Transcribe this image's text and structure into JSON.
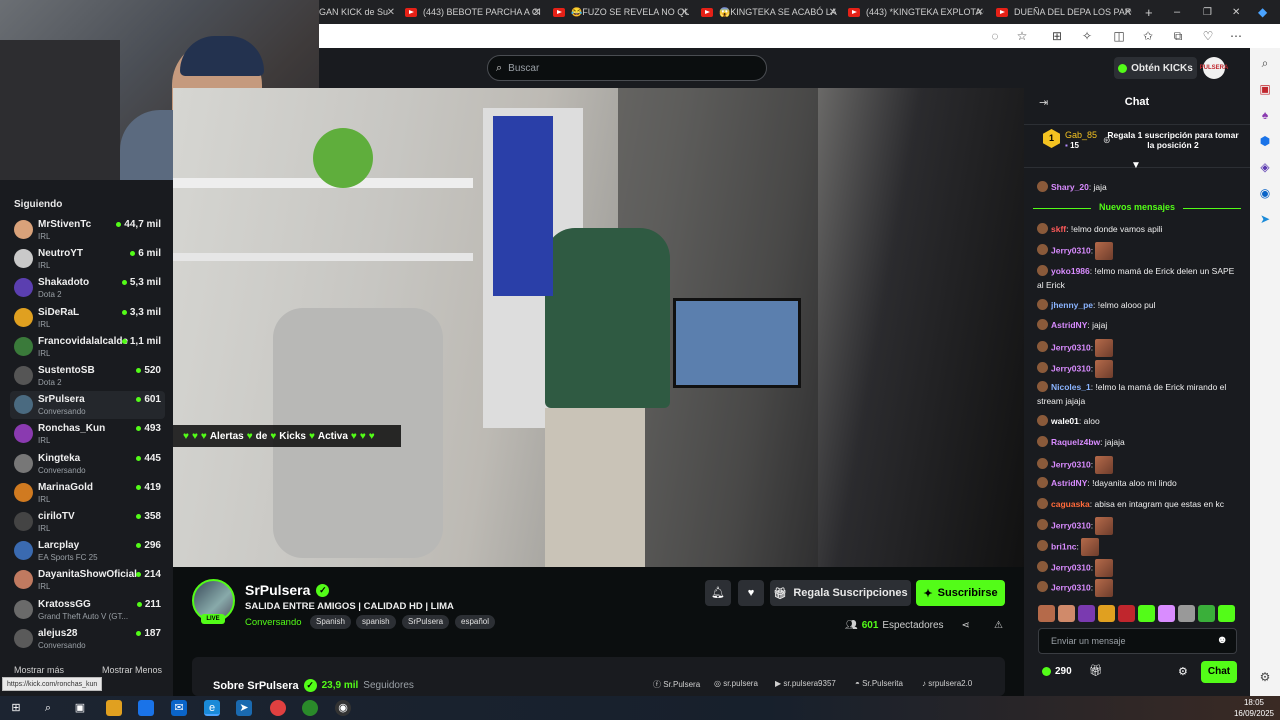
{
  "browser": {
    "tabs": [
      "GAN KICK de Su",
      "(443) BEBOTE PARCHA A CIRI",
      "😂FUZO SE REVELA NO QUI",
      "😱KINGTEKA SE ACABÓ LA A",
      "(443) *KINGTEKA EXPLOTA C",
      "DUEÑA DEL DEPA LOS PARCI"
    ],
    "new_tab": "+"
  },
  "header": {
    "search_placeholder": "Buscar",
    "kicks_button": "Obtén KICKs",
    "avatar_text": "PULSERA"
  },
  "sidebar": {
    "title": "Siguiendo",
    "items": [
      {
        "name": "MrStivenTc",
        "category": "IRL",
        "viewers": "44,7 mil",
        "color": "#d9a27a"
      },
      {
        "name": "NeutroYT",
        "category": "IRL",
        "viewers": "6 mil",
        "color": "#c9c9c9"
      },
      {
        "name": "Shakadoto",
        "category": "Dota 2",
        "viewers": "5,3 mil",
        "color": "#5b3fb0"
      },
      {
        "name": "SiDeRaL",
        "category": "IRL",
        "viewers": "3,3 mil",
        "color": "#e0a020"
      },
      {
        "name": "Francovidalalcalde",
        "category": "IRL",
        "viewers": "1,1 mil",
        "color": "#3a7a3a"
      },
      {
        "name": "SustentoSB",
        "category": "Dota 2",
        "viewers": "520",
        "color": "#555555"
      },
      {
        "name": "SrPulsera",
        "category": "Conversando",
        "viewers": "601",
        "color": "#4a6a80"
      },
      {
        "name": "Ronchas_Kun",
        "category": "IRL",
        "viewers": "493",
        "color": "#8a3ab0"
      },
      {
        "name": "Kingteka",
        "category": "Conversando",
        "viewers": "445",
        "color": "#777777"
      },
      {
        "name": "MarinaGold",
        "category": "IRL",
        "viewers": "419",
        "color": "#d07a20"
      },
      {
        "name": "ciriloTV",
        "category": "IRL",
        "viewers": "358",
        "color": "#444444"
      },
      {
        "name": "Larcplay",
        "category": "EA Sports FC 25",
        "viewers": "296",
        "color": "#3a6ab0"
      },
      {
        "name": "DayanitaShowOficial",
        "category": "IRL",
        "viewers": "214",
        "color": "#c07a60"
      },
      {
        "name": "KratossGG",
        "category": "Grand Theft Auto V (GT...",
        "viewers": "211",
        "color": "#6a6a6a"
      },
      {
        "name": "alejus28",
        "category": "Conversando",
        "viewers": "187",
        "color": "#5a5a5a"
      }
    ],
    "show_more": "Mostrar más",
    "show_less": "Mostrar Menos",
    "status_url": "https://kick.com/ronchas_kun"
  },
  "video": {
    "alert_parts": [
      "Alertas",
      "de",
      "Kicks",
      "Activa"
    ]
  },
  "channel": {
    "name": "SrPulsera",
    "live": "LIVE",
    "title": "SALIDA ENTRE AMIGOS | CALIDAD HD | LIMA",
    "category": "Conversando",
    "tags": [
      "Spanish",
      "spanish",
      "SrPulsera",
      "español"
    ],
    "gift_button": "Regala Suscripciones",
    "subscribe_button": "Suscribirse",
    "viewers_count": "601",
    "viewers_label": "Espectadores",
    "about_title": "Sobre SrPulsera",
    "followers_count": "23,9 mil",
    "followers_label": "Seguidores",
    "socials": [
      "Sr.Pulsera",
      "sr.pulsera",
      "sr.pulsera9357",
      "Sr.Pulserita",
      "srpulsera2.0"
    ]
  },
  "chat": {
    "title": "Chat",
    "gifter_name": "Gab_85",
    "gifter_count": "15",
    "gifter_rank": "1",
    "gift_info": "Regala 1 suscripción para tomar la posición 2",
    "new_messages": "Nuevos mensajes",
    "messages": [
      {
        "user": "Shary_20",
        "text": "jaja",
        "color": "#d98cff",
        "emote": false
      },
      {
        "user": "skff",
        "text": "!elmo donde vamos apili",
        "color": "#ff5a5a",
        "emote": false
      },
      {
        "user": "Jerry0310",
        "text": "",
        "color": "#d98cff",
        "emote": true
      },
      {
        "user": "yoko1986",
        "text": "!elmo mamá de Erick delen un SAPE al Erick",
        "color": "#d98cff",
        "emote": false
      },
      {
        "user": "jhenny_pe",
        "text": "!elmo alooo pul",
        "color": "#8ab4ff",
        "emote": false
      },
      {
        "user": "AstridNY",
        "text": "jajaj",
        "color": "#d98cff",
        "emote": false
      },
      {
        "user": "Jerry0310",
        "text": "",
        "color": "#d98cff",
        "emote": true
      },
      {
        "user": "Jerry0310",
        "text": "",
        "color": "#d98cff",
        "emote": true
      },
      {
        "user": "Nicoles_1",
        "text": "!elmo la mamá de Erick mirando el stream jajaja",
        "color": "#8ab4ff",
        "emote": false
      },
      {
        "user": "wale01",
        "text": "aloo",
        "color": "#ffffff",
        "emote": false
      },
      {
        "user": "Raquelz4bw",
        "text": "jajaja",
        "color": "#d98cff",
        "emote": false
      },
      {
        "user": "Jerry0310",
        "text": "",
        "color": "#d98cff",
        "emote": true
      },
      {
        "user": "AstridNY",
        "text": "!dayanita aloo mi lindo",
        "color": "#d98cff",
        "emote": false
      },
      {
        "user": "caguaska",
        "text": "abisa en intagram que estas en kc",
        "color": "#ff6a3a",
        "emote": false
      },
      {
        "user": "Jerry0310",
        "text": "",
        "color": "#d98cff",
        "emote": true
      },
      {
        "user": "bri1nc",
        "text": "",
        "color": "#d98cff",
        "emote": true
      },
      {
        "user": "Jerry0310",
        "text": "",
        "color": "#d98cff",
        "emote": true
      },
      {
        "user": "Jerry0310",
        "text": "",
        "color": "#d98cff",
        "emote": true
      }
    ],
    "input_placeholder": "Enviar un mensaje",
    "kicks_balance": "290",
    "send_button": "Chat"
  },
  "taskbar": {
    "time": "18:05",
    "date": "16/09/2025"
  },
  "colors": {
    "accent": "#53fc18",
    "background": "#0b0e0f",
    "panel": "#191b1f"
  }
}
